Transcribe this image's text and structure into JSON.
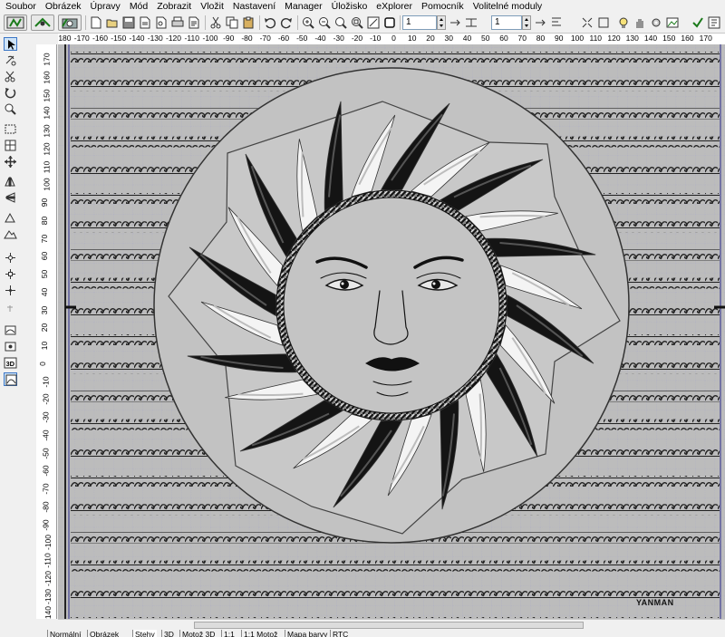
{
  "menu": [
    "Soubor",
    "Obrázek",
    "Úpravy",
    "Mód",
    "Zobrazit",
    "Vložit",
    "Nastavení",
    "Manager",
    "Úložisko",
    "eXplorer",
    "Pomocník",
    "Volitelné moduly"
  ],
  "toolbar": {
    "spin1_value": "1",
    "spin2_value": "1"
  },
  "ruler": {
    "h_labels": [
      "-180",
      "-170",
      "-160",
      "-150",
      "-140",
      "-130",
      "-120",
      "-110",
      "-100",
      "-90",
      "-80",
      "-70",
      "-60",
      "-50",
      "-40",
      "-30",
      "-20",
      "-10",
      "0",
      "10",
      "20",
      "30",
      "40",
      "50",
      "60",
      "70",
      "80",
      "90",
      "100",
      "110",
      "120",
      "130",
      "140",
      "150",
      "160",
      "170"
    ],
    "v_labels": [
      "170",
      "160",
      "150",
      "140",
      "130",
      "120",
      "110",
      "100",
      "90",
      "80",
      "70",
      "60",
      "50",
      "40",
      "30",
      "20",
      "10",
      "0",
      "-10",
      "-20",
      "-30",
      "-40",
      "-50",
      "-60",
      "-70",
      "-80",
      "-90",
      "-100",
      "-110",
      "-120",
      "-130",
      "-140"
    ]
  },
  "canvas": {
    "brand_text": "YANMAN",
    "background_color": "#bcbcbc",
    "circle_color": "#c2c2c2"
  },
  "tabs": [
    "Normální",
    "Obrázek",
    "Stehy",
    "3D",
    "Motož 3D",
    "1:1",
    "1:1 Motož",
    "Mapa barvy",
    "RTC"
  ],
  "icons": [
    "arrow-icon",
    "lasso-icon",
    "rotate-icon",
    "zoom-icon",
    "rectangle-icon",
    "grid-icon",
    "move-icon",
    "mirror-icon",
    "3d-icon"
  ]
}
